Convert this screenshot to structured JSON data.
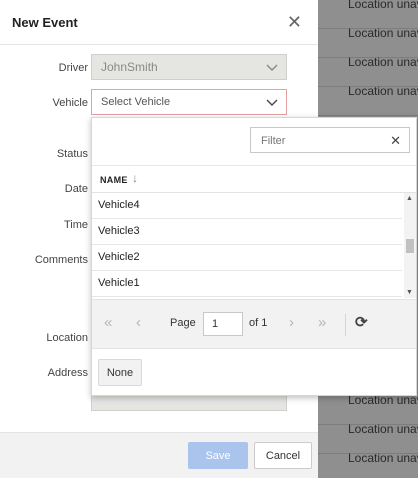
{
  "background_list": {
    "row_text": "Location unavailable",
    "top_rows": [
      "Location unavailable",
      "Location unavailable",
      "Location unavailable",
      "Location unavailable"
    ],
    "bottom_rows": [
      "Location unavailable",
      "Location unavailable",
      "Location unavailable"
    ]
  },
  "modal": {
    "title": "New Event",
    "close_icon": "close-icon",
    "fields": {
      "driver_label": "Driver",
      "driver_value": "JohnSmith",
      "vehicle_label": "Vehicle",
      "vehicle_value": "Select Vehicle",
      "status_label": "Status",
      "date_label": "Date",
      "time_label": "Time",
      "comments_label": "Comments",
      "location_label": "Location",
      "address_label": "Address"
    },
    "footer": {
      "save_label": "Save",
      "cancel_label": "Cancel"
    }
  },
  "dropdown": {
    "filter_placeholder": "Filter",
    "column_header": "NAME",
    "rows": [
      "Vehicle4",
      "Vehicle3",
      "Vehicle2",
      "Vehicle1"
    ],
    "pager": {
      "page_label": "Page",
      "page_value": "1",
      "of_label": "of 1"
    },
    "none_label": "None"
  },
  "colors": {
    "save_button": "#aac4ee",
    "invalid_border": "#e3a1a4",
    "overlay": "#8f8f8f"
  }
}
